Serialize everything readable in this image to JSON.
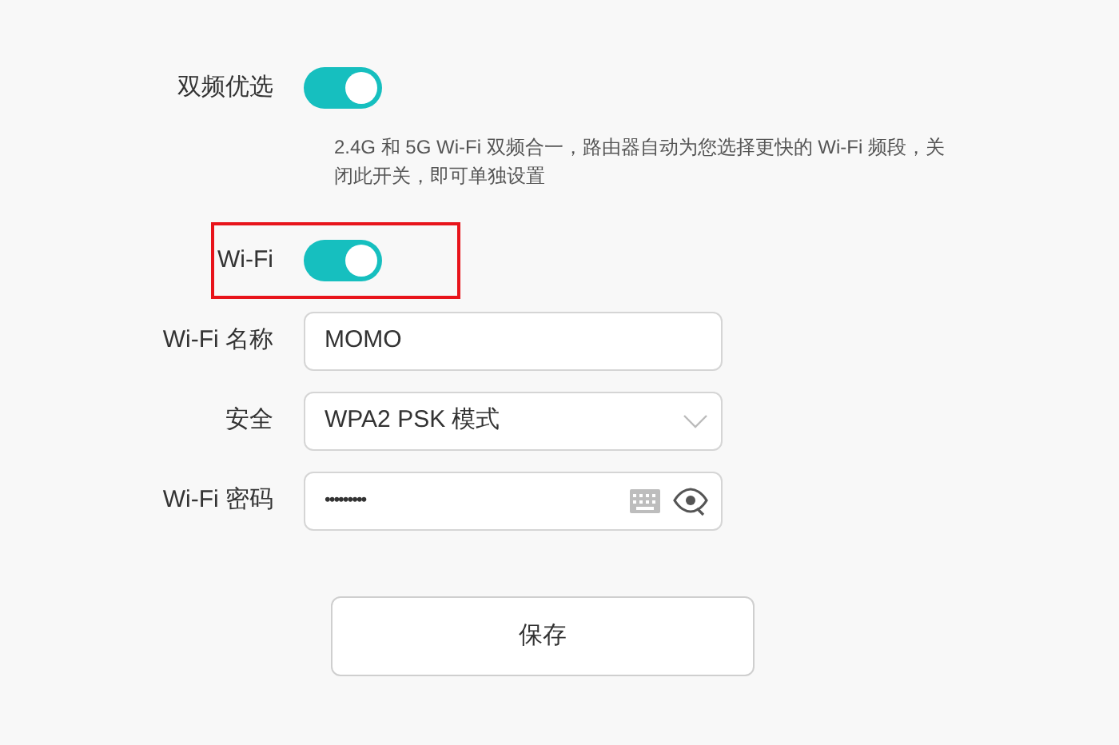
{
  "dual_band": {
    "label": "双频优选",
    "on": true,
    "description": "2.4G 和 5G Wi-Fi 双频合一，路由器自动为您选择更快的 Wi-Fi 频段，关闭此开关，即可单独设置"
  },
  "wifi": {
    "label": "Wi-Fi",
    "on": true,
    "highlighted": true
  },
  "fields": [
    {
      "kind": "text",
      "label": "Wi-Fi 名称",
      "value": "MOMO"
    },
    {
      "kind": "select",
      "label": "安全",
      "value": "WPA2 PSK 模式"
    },
    {
      "kind": "password",
      "label": "Wi-Fi 密码",
      "value": "•••••••••"
    }
  ],
  "save_button": "保存"
}
